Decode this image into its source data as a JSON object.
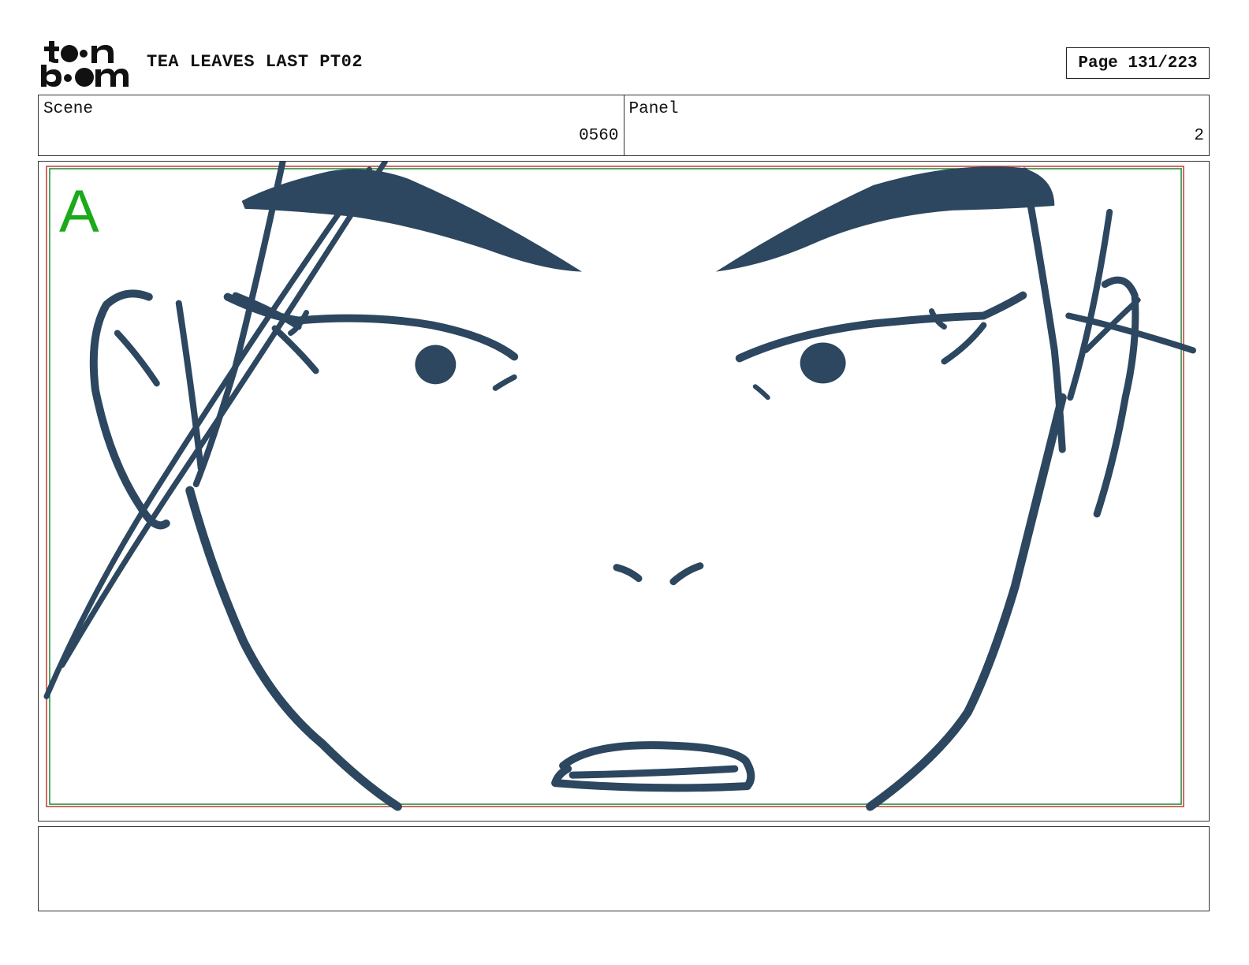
{
  "header": {
    "logo_text": "toon boom",
    "project_title": "TEA LEAVES LAST PT02",
    "page_label": "Page 131/223"
  },
  "info": {
    "scene_label": "Scene",
    "scene_value": "0560",
    "panel_label": "Panel",
    "panel_value": "2"
  },
  "panel": {
    "layer_label": "A",
    "sketch_color": "#2c475f",
    "safe_frame_colors": [
      "#c0392b",
      "#1e8a3a"
    ]
  },
  "notes": {
    "text": ""
  }
}
